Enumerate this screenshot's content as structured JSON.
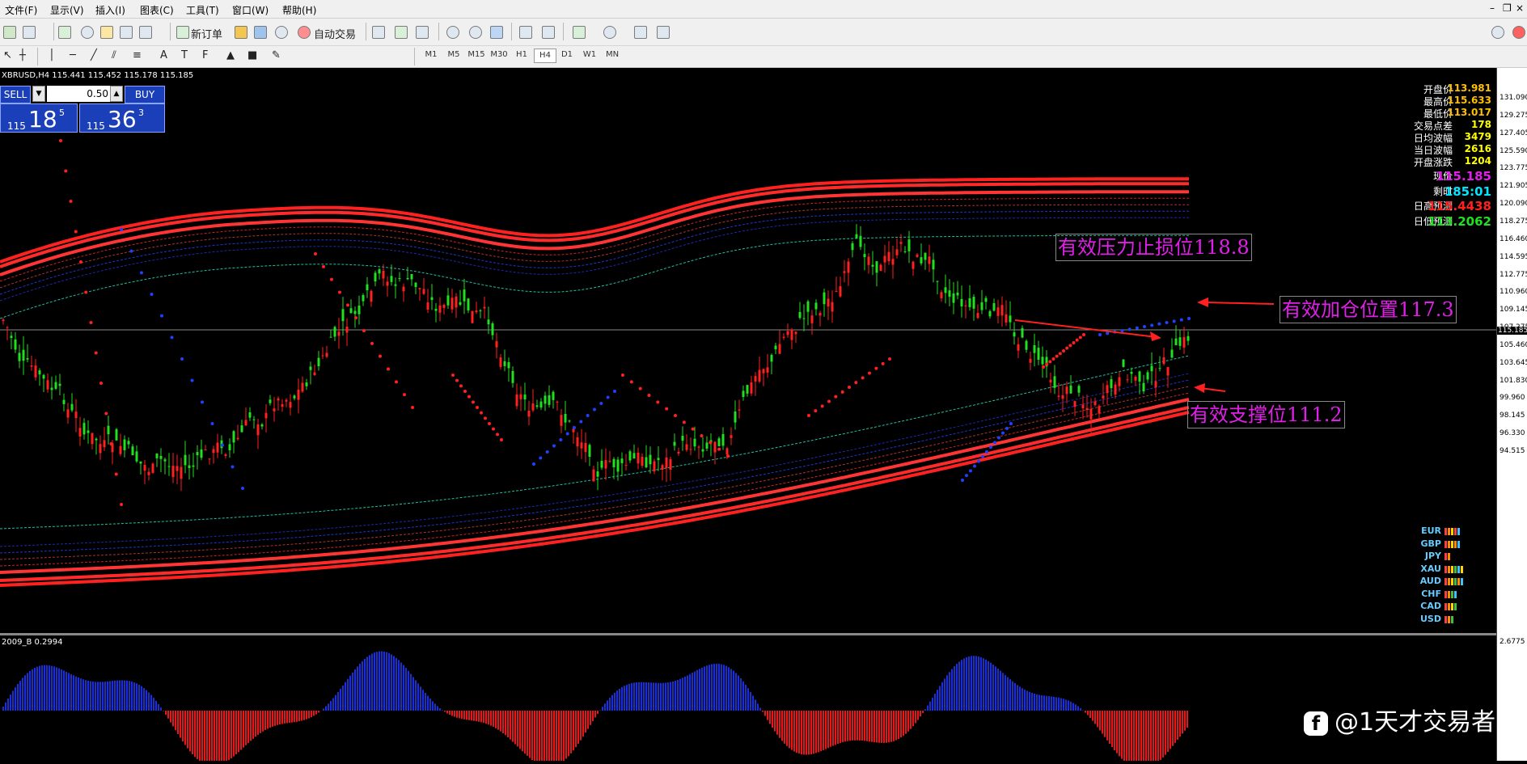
{
  "menu": [
    "文件(F)",
    "显示(V)",
    "插入(I)",
    "图表(C)",
    "工具(T)",
    "窗口(W)",
    "帮助(H)"
  ],
  "toolbar": {
    "new_order": "新订单",
    "auto_trade": "自动交易"
  },
  "timeframes": [
    "M1",
    "M5",
    "M15",
    "M30",
    "H1",
    "H4",
    "D1",
    "W1",
    "MN"
  ],
  "active_timeframe": "H4",
  "chart_title": "XBRUSD,H4  115.441 115.452 115.178 115.185",
  "trade_panel": {
    "sell_label": "SELL",
    "buy_label": "BUY",
    "lot": "0.50",
    "sell_small": "115",
    "sell_big": "18",
    "sell_sup": "5",
    "buy_small": "115",
    "buy_big": "36",
    "buy_sup": "3"
  },
  "info_panel": [
    {
      "key": "开盘价",
      "value": "113.981",
      "color": "#ffc000"
    },
    {
      "key": "最高价",
      "value": "115.633",
      "color": "#ffc000"
    },
    {
      "key": "最低价",
      "value": "113.017",
      "color": "#ffc000"
    },
    {
      "key": "交易点差",
      "value": "178",
      "color": "#ffff00"
    },
    {
      "key": "日均波幅",
      "value": "3479",
      "color": "#ffff00"
    },
    {
      "key": "当日波幅",
      "value": "2616",
      "color": "#ffff00"
    },
    {
      "key": "开盘涨跌",
      "value": "1204",
      "color": "#ffff00"
    },
    {
      "key": "现价",
      "value": "115.185",
      "color": "#e020e8"
    },
    {
      "key": "剩时",
      "value": "185:01",
      "color": "#00e5ff"
    },
    {
      "key": "日高预测",
      "value": "115.4438",
      "color": "#ff2020"
    },
    {
      "key": "日低预测",
      "value": "113.2062",
      "color": "#20e020"
    }
  ],
  "annotations": {
    "resistance": "有效压力止损位118.8",
    "add_position": "有效加仓位置117.3",
    "support": "有效支撑位111.2"
  },
  "price_axis": [
    "131.090",
    "129.275",
    "127.405",
    "125.590",
    "123.775",
    "121.905",
    "120.090",
    "118.275",
    "116.460",
    "114.595",
    "112.775",
    "110.960",
    "109.145",
    "107.275",
    "105.460",
    "103.645",
    "101.830",
    "99.960",
    "98.145",
    "96.330",
    "94.515"
  ],
  "current_price_label": "115.185",
  "osc_title": "2009_B 0.2994",
  "osc_axis_top": "2.6775",
  "currencies": [
    {
      "code": "EUR",
      "bars": [
        "#ff4040",
        "#ff8c00",
        "#ffd700",
        "#ff4040",
        "#40c0ff"
      ]
    },
    {
      "code": "GBP",
      "bars": [
        "#ff4040",
        "#ff8c00",
        "#ffd700",
        "#ff8c00",
        "#40c0ff"
      ]
    },
    {
      "code": "JPY",
      "bars": [
        "#ff4040",
        "#ff8c00"
      ]
    },
    {
      "code": "XAU",
      "bars": [
        "#ff4040",
        "#ff8c00",
        "#ffd700",
        "#40c040",
        "#40c0ff",
        "#ffd700"
      ]
    },
    {
      "code": "AUD",
      "bars": [
        "#ff4040",
        "#ff8c00",
        "#ffd700",
        "#40c040",
        "#ff8c00",
        "#40c0ff"
      ]
    },
    {
      "code": "CHF",
      "bars": [
        "#ff4040",
        "#ff8c00",
        "#40c040",
        "#40c0ff"
      ]
    },
    {
      "code": "CAD",
      "bars": [
        "#ff4040",
        "#ff8c00",
        "#ffd700",
        "#40c040"
      ]
    },
    {
      "code": "USD",
      "bars": [
        "#ff4040",
        "#ff8c00",
        "#40c040"
      ]
    }
  ],
  "watermark": "@1天才交易者"
}
